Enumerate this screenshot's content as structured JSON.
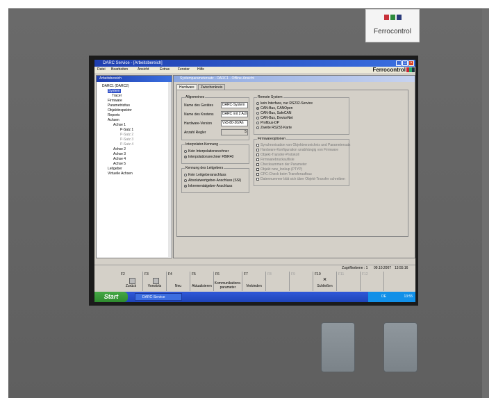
{
  "logo": {
    "text": "Ferrocontrol"
  },
  "app": {
    "title": "DARC Service - [Arbeitsbereich]",
    "brand": "Ferrocontrol",
    "menu": [
      "Datei",
      "Bearbeiten",
      "Ansicht",
      "Extras",
      "Fenster",
      "Hilfe"
    ]
  },
  "tree": {
    "title": "Arbeitsbereich",
    "items": [
      "DARC1 (DARC2)",
      "System",
      "Tracer",
      "Firmware",
      "Parametrizitus",
      "Objektinspektor",
      "Reports",
      "Achsen",
      "Achse 1",
      "P-Satz 1",
      "P-Satz 2",
      "P-Satz 3",
      "P-Satz 4",
      "Achse 2",
      "Achse 3",
      "Achse 4",
      "Achse 5",
      "Leitgeber",
      "Virtuelle Achsen"
    ]
  },
  "dialog": {
    "title": "Systemparametersatz - DARC1 - Offline-Ansicht",
    "tabs": [
      "Hardware",
      "Zwischenkreis"
    ],
    "allgemeines": {
      "title": "Allgemeines",
      "name_label": "Name des Gerätes",
      "name_value": "DARC-System",
      "knoten_label": "Name des Knotens",
      "knoten_value": "DARC mit 2 Achs",
      "hw_label": "Hardware-Version",
      "hw_value": "Vx5-80-20/Ah",
      "regler_label": "Anzahl Regler",
      "regler_value": "5"
    },
    "interpolator": {
      "title": "Interpolator-Kennung",
      "options": [
        "Kein Interpolationsrechner",
        "Interpolationsrechner FBIR40"
      ]
    },
    "leitgeber": {
      "title": "Kennung des Leitgebers",
      "options": [
        "Kein Leitgeberanschluss",
        "Absolutwertgeber-Anschluss (SSI)",
        "Inkrementalgeber-Anschluss"
      ]
    },
    "remote": {
      "title": "Remote System",
      "options": [
        "kein Interface, nur RS232-Service",
        "CAN-Bus, CANOpen",
        "CAN-Bus, SafeCAN",
        "CAN-Bus, DeviceNet",
        "Profibus-DP",
        "Zweite RS232-Karte"
      ]
    },
    "firmware": {
      "title": "Firmwareoptionen",
      "options": [
        "Synchronisation von Objektverzeichnis und Parametersatz",
        "Hardware-Konfiguration unabhängig von Firmware",
        "Objekt-Transfer-Protokoll",
        "Firmwarebruckauflisle",
        "Checksummen der Parameter",
        "Objekt new_lookup (PTYP)",
        "CPC-Check beim Transferaufbau",
        "Datennummer blät sich über Objekt-Transfer schreiben"
      ]
    }
  },
  "status": {
    "level": "Zugriffsebene : 1",
    "date": "09.10.2007",
    "time": "13:55:16"
  },
  "fkeys": [
    {
      "key": "F2",
      "label": "Zurück"
    },
    {
      "key": "F3",
      "label": "Vorwärts"
    },
    {
      "key": "F4",
      "label": "Neu"
    },
    {
      "key": "F5",
      "label": "Aktualisieren"
    },
    {
      "key": "F6",
      "label": "Kommunikations-parameter"
    },
    {
      "key": "F7",
      "label": "Verbinden"
    },
    {
      "key": "F8",
      "label": ""
    },
    {
      "key": "F9",
      "label": ""
    },
    {
      "key": "F10",
      "label": "Schließen"
    },
    {
      "key": "F11",
      "label": ""
    },
    {
      "key": "F12",
      "label": ""
    }
  ],
  "taskbar": {
    "start": "Start",
    "task": "DARC-Service",
    "tray_lang": "DE",
    "clock": "13:55"
  }
}
